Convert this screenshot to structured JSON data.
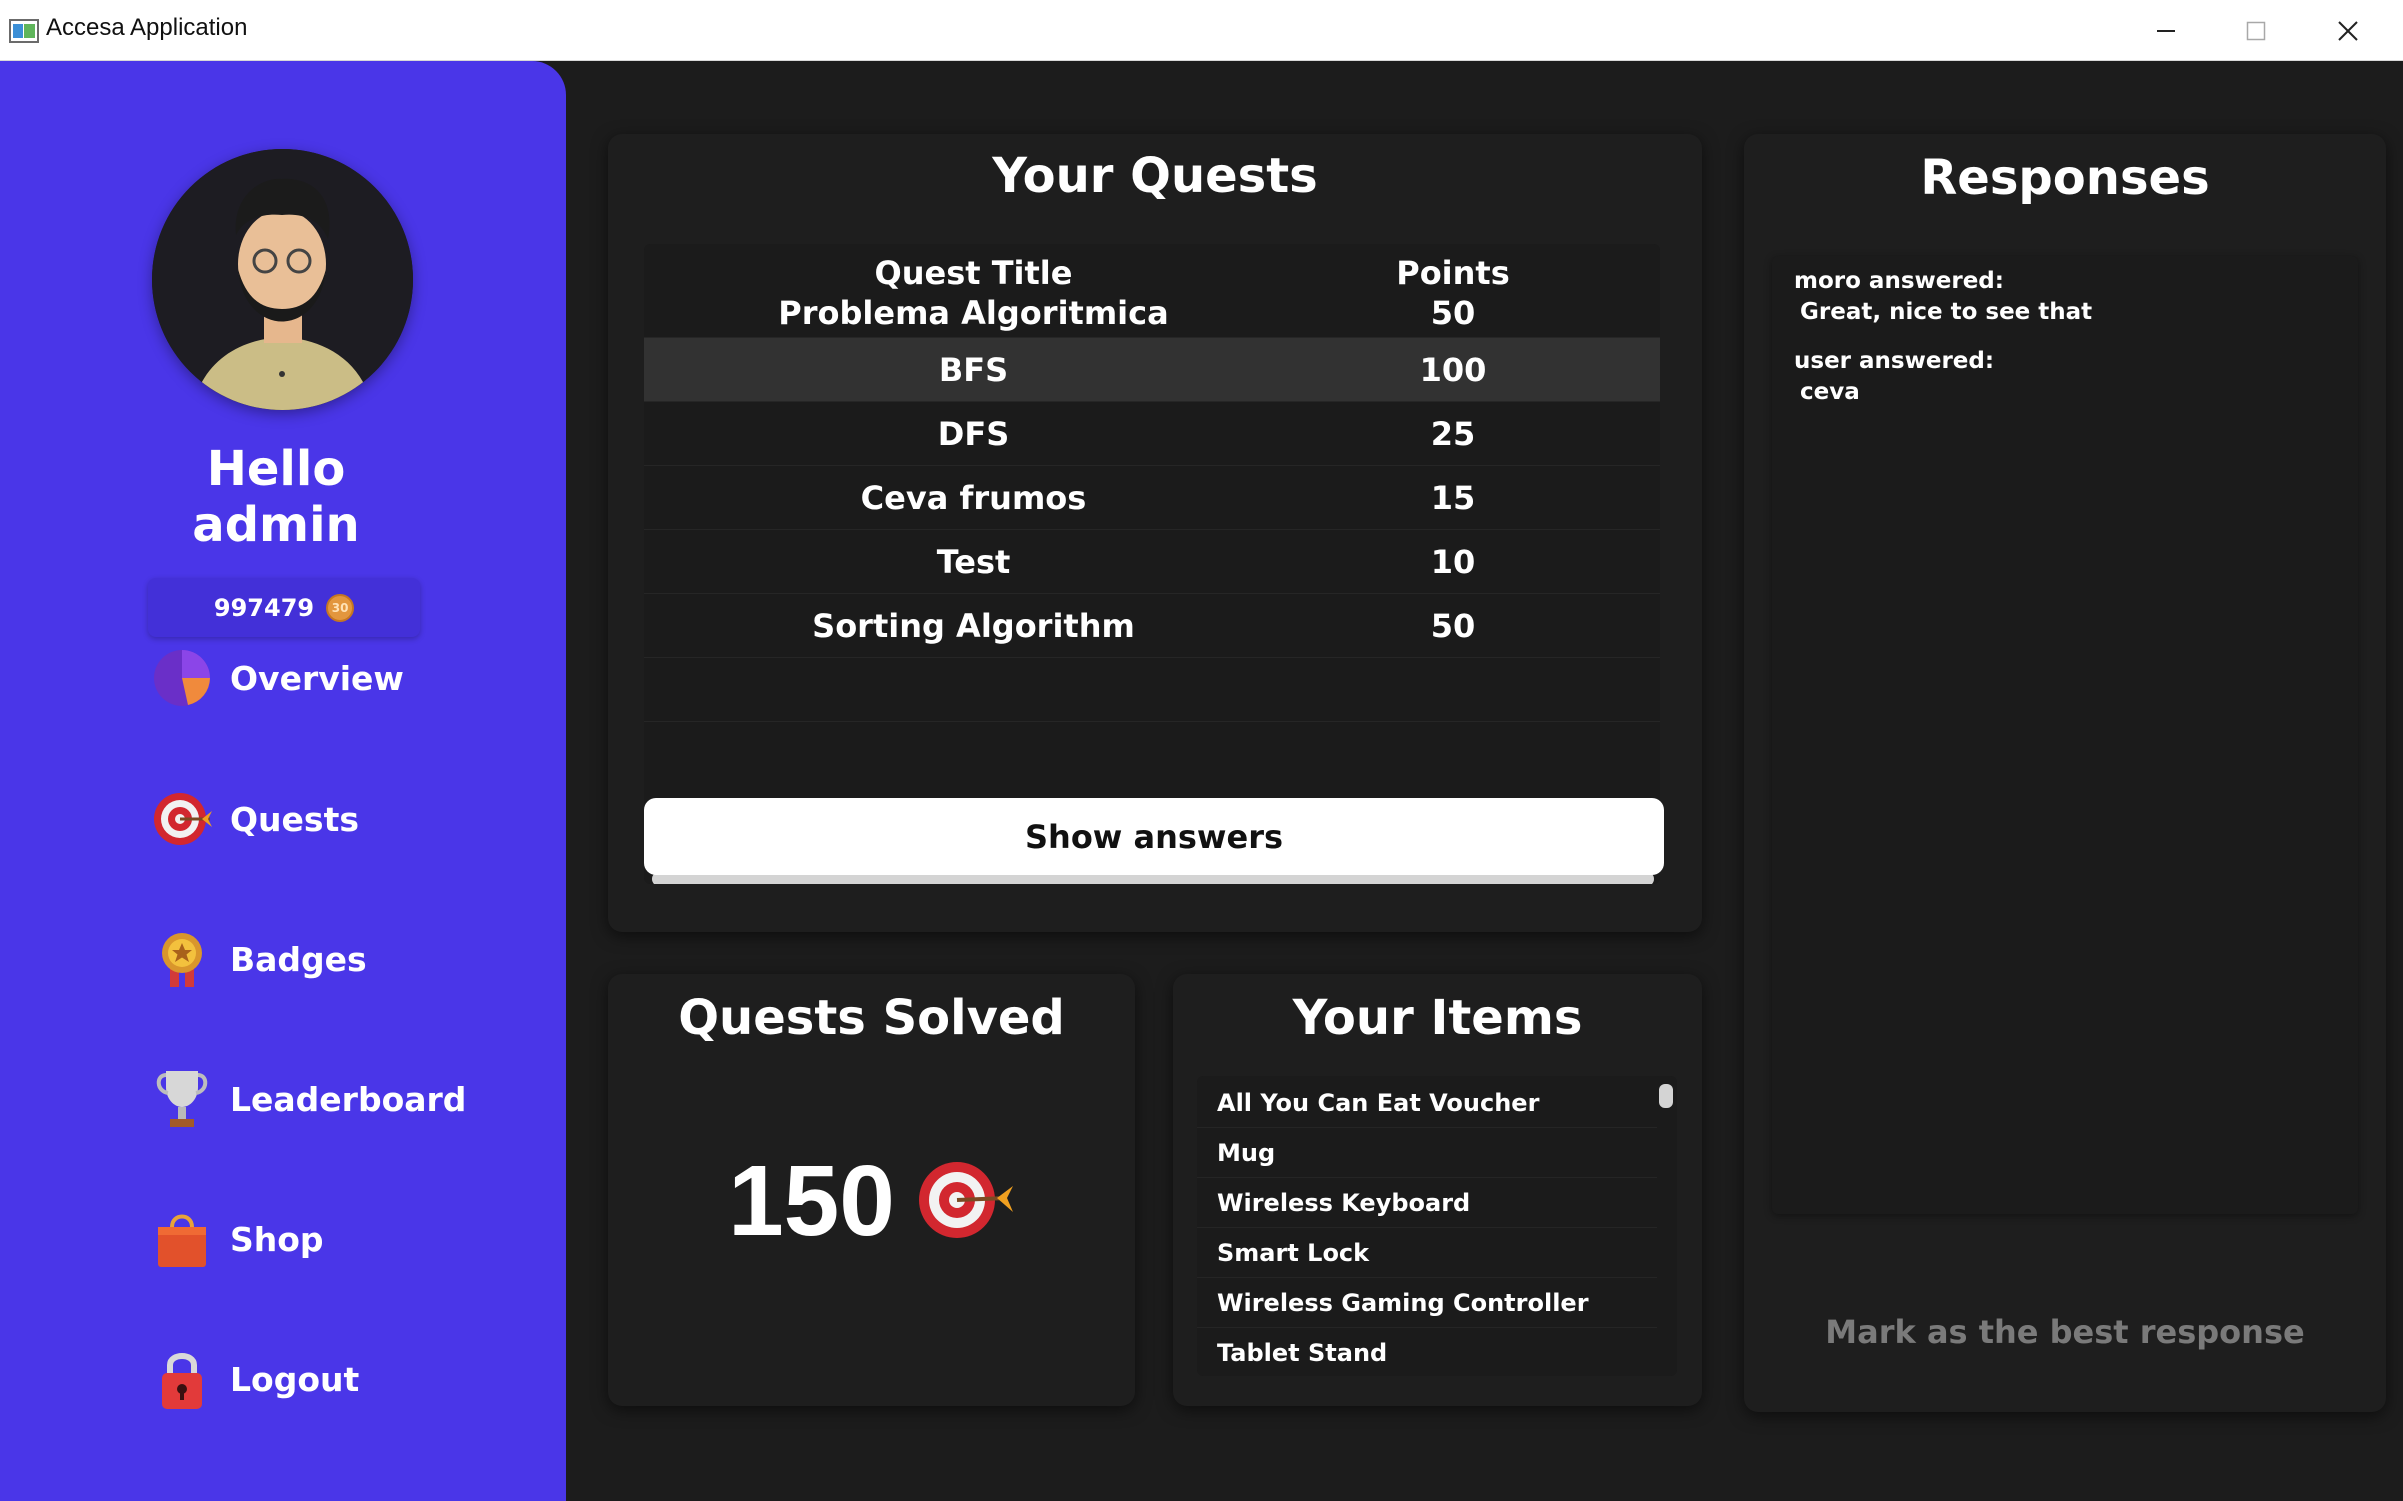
{
  "window": {
    "title": "Accesa Application"
  },
  "sidebar": {
    "greeting_line1": "Hello",
    "greeting_line2": "admin",
    "coins": "997479",
    "coin_symbol": "30",
    "items": [
      {
        "label": "Overview",
        "icon": "pie-chart-icon"
      },
      {
        "label": "Quests",
        "icon": "target-icon"
      },
      {
        "label": "Badges",
        "icon": "medal-icon"
      },
      {
        "label": "Leaderboard",
        "icon": "trophy-icon"
      },
      {
        "label": "Shop",
        "icon": "shopping-bag-icon"
      },
      {
        "label": "Logout",
        "icon": "lock-icon"
      }
    ],
    "color": "#4a36e8"
  },
  "quests": {
    "title": "Your Quests",
    "columns": [
      "Quest Title",
      "Points"
    ],
    "rows": [
      {
        "title": "Problema Algoritmica",
        "points": "50"
      },
      {
        "title": "BFS",
        "points": "100"
      },
      {
        "title": "DFS",
        "points": "25"
      },
      {
        "title": "Ceva frumos",
        "points": "15"
      },
      {
        "title": "Test",
        "points": "10"
      },
      {
        "title": "Sorting Algorithm",
        "points": "50"
      }
    ],
    "selected_row": "BFS",
    "button": "Show answers"
  },
  "solved": {
    "title": "Quests Solved",
    "value": "150"
  },
  "items": {
    "title": "Your Items",
    "list": [
      "All You Can Eat Voucher",
      "Mug",
      "Wireless Keyboard",
      "Smart Lock",
      "Wireless Gaming Controller",
      "Tablet Stand"
    ]
  },
  "responses": {
    "title": "Responses",
    "entries": [
      {
        "author": "moro answered:",
        "text": "Great, nice to see that"
      },
      {
        "author": "user answered:",
        "text": "ceva"
      }
    ],
    "button": "Mark as the best response"
  }
}
